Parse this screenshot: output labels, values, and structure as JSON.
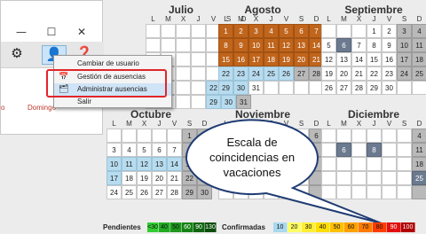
{
  "colors": {
    "white": "#ffffff",
    "gray": "#b9b9b9",
    "blue": "#b8dcef",
    "orange": "#c0651c",
    "slate": "#6c7a90",
    "highlight_red": "#e0262a"
  },
  "day_headers": [
    "L",
    "M",
    "X",
    "J",
    "V",
    "S",
    "D"
  ],
  "months": [
    {
      "name": "Julio",
      "days": [
        {
          "n": "",
          "s": "d-white"
        },
        {
          "n": "",
          "s": "d-white"
        },
        {
          "n": "",
          "s": "d-white"
        },
        {
          "n": "",
          "s": "d-white"
        },
        {
          "n": "",
          "s": "d-white"
        },
        {
          "n": "1",
          "s": "d-gray"
        },
        {
          "n": "2",
          "s": "d-gray"
        },
        {
          "n": "",
          "s": "d-white"
        },
        {
          "n": "",
          "s": "d-white"
        },
        {
          "n": "",
          "s": "d-white"
        },
        {
          "n": "",
          "s": "d-white"
        },
        {
          "n": "",
          "s": "d-white"
        },
        {
          "n": "",
          "s": "d-gray"
        },
        {
          "n": "",
          "s": "d-gray"
        },
        {
          "n": "",
          "s": "d-white"
        },
        {
          "n": "",
          "s": "d-white"
        },
        {
          "n": "",
          "s": "d-white"
        },
        {
          "n": "",
          "s": "d-white"
        },
        {
          "n": "",
          "s": "d-white"
        },
        {
          "n": "",
          "s": "d-gray"
        },
        {
          "n": "",
          "s": "d-gray"
        },
        {
          "n": "",
          "s": "d-white"
        },
        {
          "n": "",
          "s": "d-white"
        },
        {
          "n": "",
          "s": "d-white"
        },
        {
          "n": "",
          "s": "d-white"
        },
        {
          "n": "",
          "s": "d-white"
        },
        {
          "n": "",
          "s": "d-gray"
        },
        {
          "n": "",
          "s": "d-gray"
        },
        {
          "n": "",
          "s": "d-white"
        },
        {
          "n": "",
          "s": "d-white"
        },
        {
          "n": "",
          "s": "d-white"
        },
        {
          "n": "",
          "s": "d-white"
        },
        {
          "n": "22",
          "s": "d-blue"
        },
        {
          "n": "23",
          "s": "d-blue"
        },
        {
          "n": "24",
          "s": "d-gray"
        },
        {
          "n": "",
          "s": "d-white"
        },
        {
          "n": "",
          "s": "d-white"
        },
        {
          "n": "",
          "s": "d-white"
        },
        {
          "n": "",
          "s": "d-white"
        },
        {
          "n": "29",
          "s": "d-blue"
        },
        {
          "n": "30",
          "s": "d-blue"
        },
        {
          "n": "31",
          "s": "d-gray"
        }
      ]
    },
    {
      "name": "Agosto",
      "days": [
        {
          "n": "1",
          "s": "d-orange"
        },
        {
          "n": "2",
          "s": "d-orange"
        },
        {
          "n": "3",
          "s": "d-orange"
        },
        {
          "n": "4",
          "s": "d-orange"
        },
        {
          "n": "5",
          "s": "d-orange"
        },
        {
          "n": "6",
          "s": "d-orange"
        },
        {
          "n": "7",
          "s": "d-orange"
        },
        {
          "n": "8",
          "s": "d-orange"
        },
        {
          "n": "9",
          "s": "d-orange"
        },
        {
          "n": "10",
          "s": "d-orange"
        },
        {
          "n": "11",
          "s": "d-orange"
        },
        {
          "n": "12",
          "s": "d-orange"
        },
        {
          "n": "13",
          "s": "d-orange"
        },
        {
          "n": "14",
          "s": "d-orange"
        },
        {
          "n": "15",
          "s": "d-orange"
        },
        {
          "n": "16",
          "s": "d-orange"
        },
        {
          "n": "17",
          "s": "d-orange"
        },
        {
          "n": "18",
          "s": "d-orange"
        },
        {
          "n": "19",
          "s": "d-orange"
        },
        {
          "n": "20",
          "s": "d-orange"
        },
        {
          "n": "21",
          "s": "d-orange"
        },
        {
          "n": "22",
          "s": "d-blue"
        },
        {
          "n": "23",
          "s": "d-blue"
        },
        {
          "n": "24",
          "s": "d-blue"
        },
        {
          "n": "25",
          "s": "d-blue"
        },
        {
          "n": "26",
          "s": "d-blue"
        },
        {
          "n": "27",
          "s": "d-gray"
        },
        {
          "n": "28",
          "s": "d-gray"
        },
        {
          "n": "29",
          "s": "d-blue"
        },
        {
          "n": "30",
          "s": "d-blue"
        },
        {
          "n": "31",
          "s": "d-white"
        },
        {
          "n": "",
          "s": "d-white"
        },
        {
          "n": "",
          "s": "d-white"
        },
        {
          "n": "",
          "s": "d-white"
        },
        {
          "n": "",
          "s": "d-white"
        }
      ]
    },
    {
      "name": "Septiembre",
      "days": [
        {
          "n": "",
          "s": "d-white"
        },
        {
          "n": "",
          "s": "d-white"
        },
        {
          "n": "",
          "s": "d-white"
        },
        {
          "n": "1",
          "s": "d-white"
        },
        {
          "n": "2",
          "s": "d-white"
        },
        {
          "n": "3",
          "s": "d-gray"
        },
        {
          "n": "4",
          "s": "d-gray"
        },
        {
          "n": "5",
          "s": "d-white"
        },
        {
          "n": "6",
          "s": "d-slate"
        },
        {
          "n": "7",
          "s": "d-white"
        },
        {
          "n": "8",
          "s": "d-white"
        },
        {
          "n": "9",
          "s": "d-white"
        },
        {
          "n": "10",
          "s": "d-gray"
        },
        {
          "n": "11",
          "s": "d-gray"
        },
        {
          "n": "12",
          "s": "d-white"
        },
        {
          "n": "13",
          "s": "d-white"
        },
        {
          "n": "14",
          "s": "d-white"
        },
        {
          "n": "15",
          "s": "d-white"
        },
        {
          "n": "16",
          "s": "d-white"
        },
        {
          "n": "17",
          "s": "d-gray"
        },
        {
          "n": "18",
          "s": "d-gray"
        },
        {
          "n": "19",
          "s": "d-white"
        },
        {
          "n": "20",
          "s": "d-white"
        },
        {
          "n": "21",
          "s": "d-white"
        },
        {
          "n": "22",
          "s": "d-white"
        },
        {
          "n": "23",
          "s": "d-white"
        },
        {
          "n": "24",
          "s": "d-gray"
        },
        {
          "n": "25",
          "s": "d-gray"
        },
        {
          "n": "26",
          "s": "d-white"
        },
        {
          "n": "27",
          "s": "d-white"
        },
        {
          "n": "28",
          "s": "d-white"
        },
        {
          "n": "29",
          "s": "d-white"
        },
        {
          "n": "30",
          "s": "d-white"
        },
        {
          "n": "",
          "s": "d-white"
        },
        {
          "n": "",
          "s": "d-white"
        }
      ]
    },
    {
      "name": "Octubre",
      "days": [
        {
          "n": "",
          "s": "d-white"
        },
        {
          "n": "",
          "s": "d-white"
        },
        {
          "n": "",
          "s": "d-white"
        },
        {
          "n": "",
          "s": "d-white"
        },
        {
          "n": "",
          "s": "d-white"
        },
        {
          "n": "1",
          "s": "d-gray"
        },
        {
          "n": "2",
          "s": "d-gray"
        },
        {
          "n": "3",
          "s": "d-white"
        },
        {
          "n": "4",
          "s": "d-white"
        },
        {
          "n": "5",
          "s": "d-white"
        },
        {
          "n": "6",
          "s": "d-white"
        },
        {
          "n": "7",
          "s": "d-white"
        },
        {
          "n": "8",
          "s": "d-gray"
        },
        {
          "n": "9",
          "s": "d-gray"
        },
        {
          "n": "10",
          "s": "d-blue"
        },
        {
          "n": "11",
          "s": "d-blue"
        },
        {
          "n": "12",
          "s": "d-blue"
        },
        {
          "n": "13",
          "s": "d-blue"
        },
        {
          "n": "14",
          "s": "d-blue"
        },
        {
          "n": "15",
          "s": "d-gray"
        },
        {
          "n": "16",
          "s": "d-gray"
        },
        {
          "n": "17",
          "s": "d-blue"
        },
        {
          "n": "18",
          "s": "d-white"
        },
        {
          "n": "19",
          "s": "d-white"
        },
        {
          "n": "20",
          "s": "d-white"
        },
        {
          "n": "21",
          "s": "d-white"
        },
        {
          "n": "22",
          "s": "d-gray"
        },
        {
          "n": "23",
          "s": "d-gray"
        },
        {
          "n": "24",
          "s": "d-white"
        },
        {
          "n": "25",
          "s": "d-white"
        },
        {
          "n": "26",
          "s": "d-white"
        },
        {
          "n": "27",
          "s": "d-white"
        },
        {
          "n": "28",
          "s": "d-white"
        },
        {
          "n": "29",
          "s": "d-gray"
        },
        {
          "n": "30",
          "s": "d-gray"
        }
      ]
    },
    {
      "name": "Noviembre",
      "days": [
        {
          "n": "",
          "s": "d-white"
        },
        {
          "n": "",
          "s": "d-white"
        },
        {
          "n": "",
          "s": "d-white"
        },
        {
          "n": "",
          "s": "d-white"
        },
        {
          "n": "",
          "s": "d-white"
        },
        {
          "n": "",
          "s": "d-white"
        },
        {
          "n": "6",
          "s": "d-gray"
        },
        {
          "n": "",
          "s": "d-white"
        },
        {
          "n": "",
          "s": "d-white"
        },
        {
          "n": "",
          "s": "d-white"
        },
        {
          "n": "",
          "s": "d-white"
        },
        {
          "n": "",
          "s": "d-white"
        },
        {
          "n": "",
          "s": "d-white"
        },
        {
          "n": "",
          "s": "d-gray"
        },
        {
          "n": "",
          "s": "d-white"
        },
        {
          "n": "",
          "s": "d-white"
        },
        {
          "n": "",
          "s": "d-white"
        },
        {
          "n": "",
          "s": "d-white"
        },
        {
          "n": "",
          "s": "d-white"
        },
        {
          "n": "",
          "s": "d-white"
        },
        {
          "n": "",
          "s": "d-gray"
        },
        {
          "n": "",
          "s": "d-white"
        },
        {
          "n": "",
          "s": "d-white"
        },
        {
          "n": "",
          "s": "d-white"
        },
        {
          "n": "",
          "s": "d-white"
        },
        {
          "n": "",
          "s": "d-white"
        },
        {
          "n": "",
          "s": "d-white"
        },
        {
          "n": "",
          "s": "d-gray"
        },
        {
          "n": "",
          "s": "d-white"
        },
        {
          "n": "",
          "s": "d-white"
        },
        {
          "n": "",
          "s": "d-white"
        },
        {
          "n": "",
          "s": "d-white"
        },
        {
          "n": "",
          "s": "d-white"
        },
        {
          "n": "",
          "s": "d-white"
        },
        {
          "n": "",
          "s": "d-gray"
        }
      ]
    },
    {
      "name": "Diciembre",
      "days": [
        {
          "n": "",
          "s": "d-white"
        },
        {
          "n": "",
          "s": "d-white"
        },
        {
          "n": "",
          "s": "d-white"
        },
        {
          "n": "",
          "s": "d-white"
        },
        {
          "n": "",
          "s": "d-white"
        },
        {
          "n": "",
          "s": "d-white"
        },
        {
          "n": "4",
          "s": "d-gray"
        },
        {
          "n": "",
          "s": "d-white"
        },
        {
          "n": "6",
          "s": "d-slate"
        },
        {
          "n": "",
          "s": "d-white"
        },
        {
          "n": "8",
          "s": "d-slate"
        },
        {
          "n": "",
          "s": "d-white"
        },
        {
          "n": "",
          "s": "d-white"
        },
        {
          "n": "11",
          "s": "d-gray"
        },
        {
          "n": "",
          "s": "d-white"
        },
        {
          "n": "",
          "s": "d-white"
        },
        {
          "n": "",
          "s": "d-white"
        },
        {
          "n": "",
          "s": "d-white"
        },
        {
          "n": "",
          "s": "d-white"
        },
        {
          "n": "",
          "s": "d-white"
        },
        {
          "n": "18",
          "s": "d-gray"
        },
        {
          "n": "",
          "s": "d-white"
        },
        {
          "n": "",
          "s": "d-white"
        },
        {
          "n": "",
          "s": "d-white"
        },
        {
          "n": "",
          "s": "d-white"
        },
        {
          "n": "",
          "s": "d-white"
        },
        {
          "n": "",
          "s": "d-white"
        },
        {
          "n": "25",
          "s": "d-slate"
        },
        {
          "n": "",
          "s": "d-white"
        },
        {
          "n": "",
          "s": "d-white"
        },
        {
          "n": "",
          "s": "d-white"
        },
        {
          "n": "",
          "s": "d-white"
        },
        {
          "n": "",
          "s": "d-white"
        },
        {
          "n": "",
          "s": "d-white"
        },
        {
          "n": "",
          "s": "d-gray"
        }
      ]
    }
  ],
  "window": {
    "controls": [
      {
        "label": "—",
        "icon": "minimize-icon"
      },
      {
        "label": "☐",
        "icon": "maximize-icon"
      },
      {
        "label": "✕",
        "icon": "close-icon"
      }
    ],
    "toolbar": {
      "settings_icon": "⚙",
      "settings_icon_name": "gear-icon",
      "user_icon": "👤",
      "user_icon_name": "user-icon",
      "help_icon": "❓",
      "help_icon_name": "help-icon"
    },
    "day_labels": [
      "o",
      "Domingo"
    ]
  },
  "context_menu": {
    "items": [
      {
        "label": "Cambiar de usuario",
        "icon": "",
        "icon_name": "",
        "highlighted": false
      },
      {
        "label": "Gestión de ausencias",
        "icon": "📅",
        "icon_name": "calendar-icon",
        "highlighted": false
      },
      {
        "label": "Administrar ausencias",
        "icon": "🗂",
        "icon_name": "admin-calendar-icon",
        "highlighted": true
      },
      {
        "label": "Salir",
        "icon": "",
        "icon_name": "",
        "highlighted": false
      }
    ]
  },
  "callout": {
    "lines": [
      "Escala de",
      "coincidencias en",
      "vacaciones"
    ]
  },
  "legend": {
    "pending_label": "Pendientes",
    "pending_scale": [
      {
        "label": "<30",
        "color": "#33cc33"
      },
      {
        "label": "40",
        "color": "#22aa22"
      },
      {
        "label": "50",
        "color": "#1e961e"
      },
      {
        "label": "60",
        "color": "#178217"
      },
      {
        "label": "90",
        "color": "#116611"
      },
      {
        "label": "130",
        "color": "#0b4d0b"
      }
    ],
    "confirmed_label": "Confirmadas",
    "confirmed_scale": [
      {
        "label": "10",
        "color": "#a9d8ef"
      },
      {
        "label": "20",
        "color": "#ffff66"
      },
      {
        "label": "30",
        "color": "#ffee33"
      },
      {
        "label": "40",
        "color": "#ffdd00"
      },
      {
        "label": "50",
        "color": "#ffc000"
      },
      {
        "label": "60",
        "color": "#ffa000"
      },
      {
        "label": "70",
        "color": "#ff7a00"
      },
      {
        "label": "80",
        "color": "#ff3c00"
      },
      {
        "label": "90",
        "color": "#e01010"
      },
      {
        "label": "100",
        "color": "#b00000"
      }
    ]
  }
}
